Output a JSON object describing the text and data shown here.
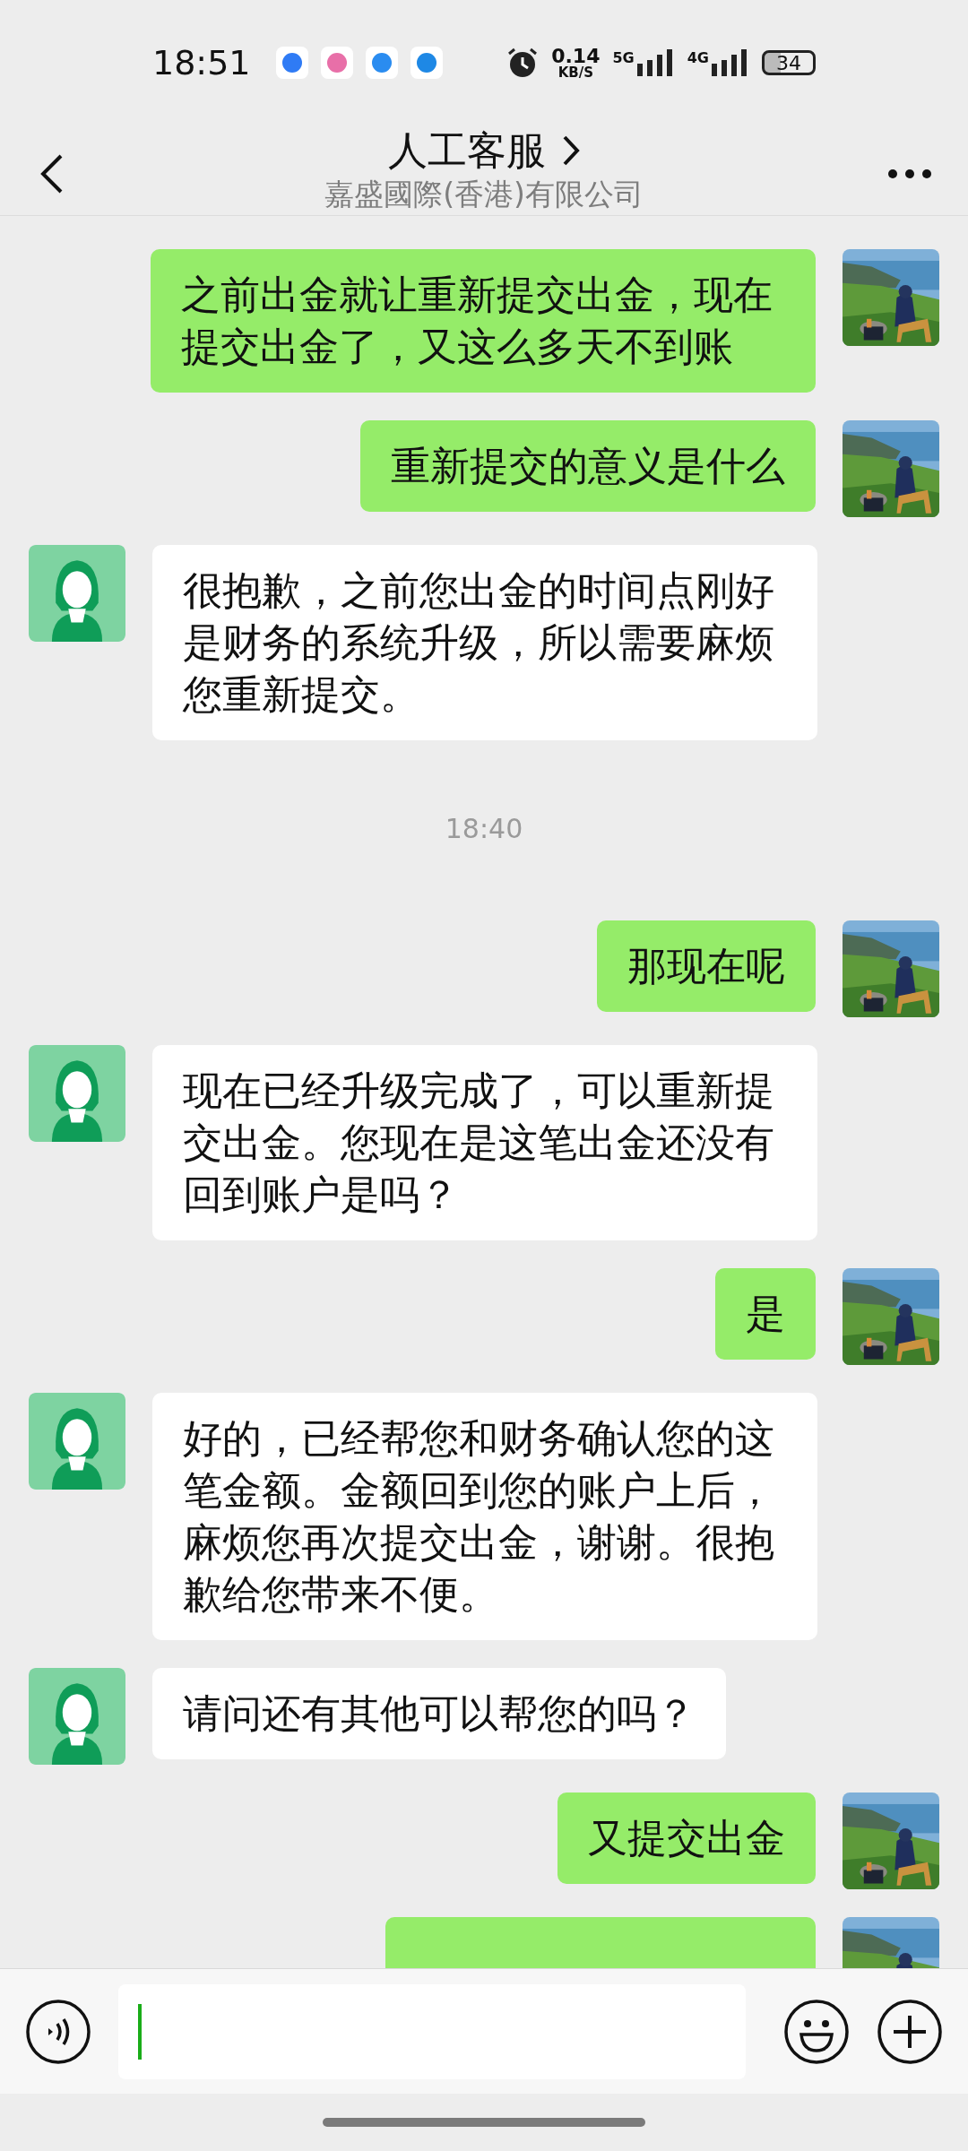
{
  "status_bar": {
    "time": "18:51",
    "net_speed": "0.14",
    "net_unit": "KB/S",
    "signal_1": "5G",
    "signal_2": "4G",
    "battery": "34"
  },
  "header": {
    "title": "人工客服",
    "subtitle": "嘉盛國際(香港)有限公司"
  },
  "messages": [
    {
      "kind": "sent",
      "text": "之前出金就让重新提交出金，现在提交出金了，又这么多天不到账"
    },
    {
      "kind": "sent",
      "text": "重新提交的意义是什么"
    },
    {
      "kind": "received",
      "text": "很抱歉，之前您出金的时间点刚好是财务的系统升级，所以需要麻烦您重新提交。"
    },
    {
      "kind": "time",
      "text": "18:40"
    },
    {
      "kind": "sent",
      "text": "那现在呢"
    },
    {
      "kind": "received",
      "text": "现在已经升级完成了，可以重新提交出金。您现在是这笔出金还没有回到账户是吗？"
    },
    {
      "kind": "sent",
      "text": "是"
    },
    {
      "kind": "received",
      "text": "好的，已经帮您和财务确认您的这笔金额。金额回到您的账户上后，麻烦您再次提交出金，谢谢。很抱歉给您带来不便。"
    },
    {
      "kind": "received",
      "text": "请问还有其他可以帮您的吗？"
    },
    {
      "kind": "sent",
      "text": "又提交出金"
    },
    {
      "kind": "sent"
    }
  ]
}
